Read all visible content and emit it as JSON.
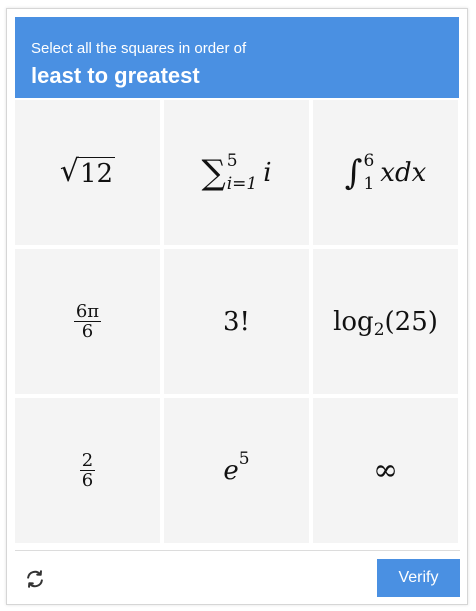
{
  "header": {
    "instruction": "Select all the squares in order of",
    "task": "least to greatest",
    "color": "#4a90e2"
  },
  "tiles": [
    {
      "latex": "\\sqrt{12}",
      "radicand": "12"
    },
    {
      "latex": "\\sum_{i=1}^{5} i",
      "upper": "5",
      "lower": "i=1",
      "body": "i"
    },
    {
      "latex": "\\int_1^6 x dx",
      "upper": "6",
      "lower": "1",
      "body": "xdx"
    },
    {
      "latex": "\\frac{6\\pi}{6}",
      "numerator": "6π",
      "denominator": "6"
    },
    {
      "latex": "3!",
      "text": "3!"
    },
    {
      "latex": "\\log_2(25)",
      "fn": "log",
      "base": "2",
      "arg": "(25)"
    },
    {
      "latex": "\\frac{2}{6}",
      "numerator": "2",
      "denominator": "6"
    },
    {
      "latex": "e^5",
      "base": "e",
      "exponent": "5"
    },
    {
      "latex": "\\infty",
      "text": "∞"
    }
  ],
  "footer": {
    "reload_icon": "reload-icon",
    "verify_label": "Verify",
    "verify_color": "#4a90e2"
  }
}
